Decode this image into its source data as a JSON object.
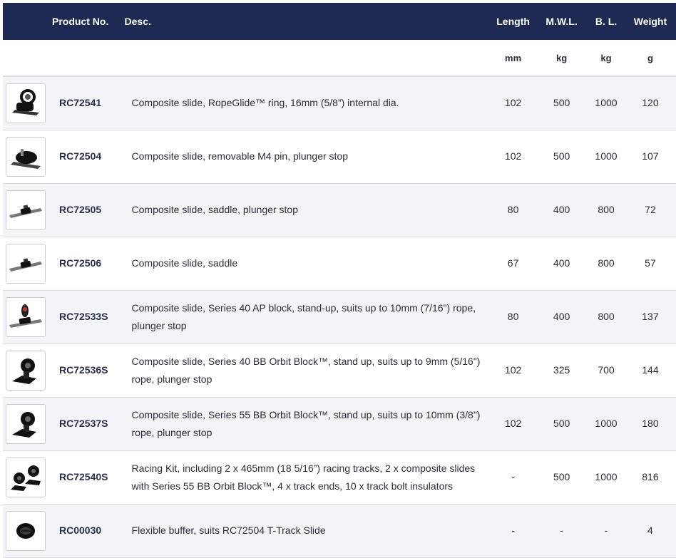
{
  "table": {
    "headers": {
      "product_no": "Product No.",
      "desc": "Desc.",
      "length": "Length",
      "mwl": "M.W.L.",
      "bl": "B. L.",
      "weight": "Weight"
    },
    "units": {
      "length": "mm",
      "mwl": "kg",
      "bl": "kg",
      "weight": "g"
    },
    "rows": [
      {
        "product_no": "RC72541",
        "desc": "Composite slide, RopeGlide™ ring, 16mm (5/8”) internal dia.",
        "length": "102",
        "mwl": "500",
        "bl": "1000",
        "weight": "120",
        "icon": "slide-ring-icon"
      },
      {
        "product_no": "RC72504",
        "desc": "Composite slide, removable M4 pin, plunger stop",
        "length": "102",
        "mwl": "500",
        "bl": "1000",
        "weight": "107",
        "icon": "slide-pin-icon"
      },
      {
        "product_no": "RC72505",
        "desc": "Composite slide, saddle, plunger stop",
        "length": "80",
        "mwl": "400",
        "bl": "800",
        "weight": "72",
        "icon": "slide-saddle-icon"
      },
      {
        "product_no": "RC72506",
        "desc": "Composite slide, saddle",
        "length": "67",
        "mwl": "400",
        "bl": "800",
        "weight": "57",
        "icon": "slide-saddle-icon"
      },
      {
        "product_no": "RC72533S",
        "desc": "Composite slide, Series 40 AP block, stand-up, suits up to 10mm (7/16\") rope, plunger stop",
        "length": "80",
        "mwl": "400",
        "bl": "800",
        "weight": "137",
        "icon": "slide-block-icon"
      },
      {
        "product_no": "RC72536S",
        "desc": "Composite slide, Series 40 BB Orbit Block™, stand up, suits up to 9mm (5/16\") rope, plunger stop",
        "length": "102",
        "mwl": "325",
        "bl": "700",
        "weight": "144",
        "icon": "orbit-block-icon"
      },
      {
        "product_no": "RC72537S",
        "desc": "Composite slide, Series 55 BB Orbit Block™, stand up, suits up to 10mm (3/8\") rope, plunger stop",
        "length": "102",
        "mwl": "500",
        "bl": "1000",
        "weight": "180",
        "icon": "orbit-block-icon"
      },
      {
        "product_no": "RC72540S",
        "desc": "Racing Kit, including 2 x 465mm (18 5/16”) racing tracks, 2 x composite slides with Series 55 BB Orbit Block™, 4 x track ends, 10 x track bolt insulators",
        "length": "-",
        "mwl": "500",
        "bl": "1000",
        "weight": "816",
        "icon": "racing-kit-icon"
      },
      {
        "product_no": "RC00030",
        "desc": "Flexible buffer, suits RC72504 T-Track Slide",
        "length": "-",
        "mwl": "-",
        "bl": "-",
        "weight": "4",
        "icon": "buffer-icon"
      }
    ]
  }
}
